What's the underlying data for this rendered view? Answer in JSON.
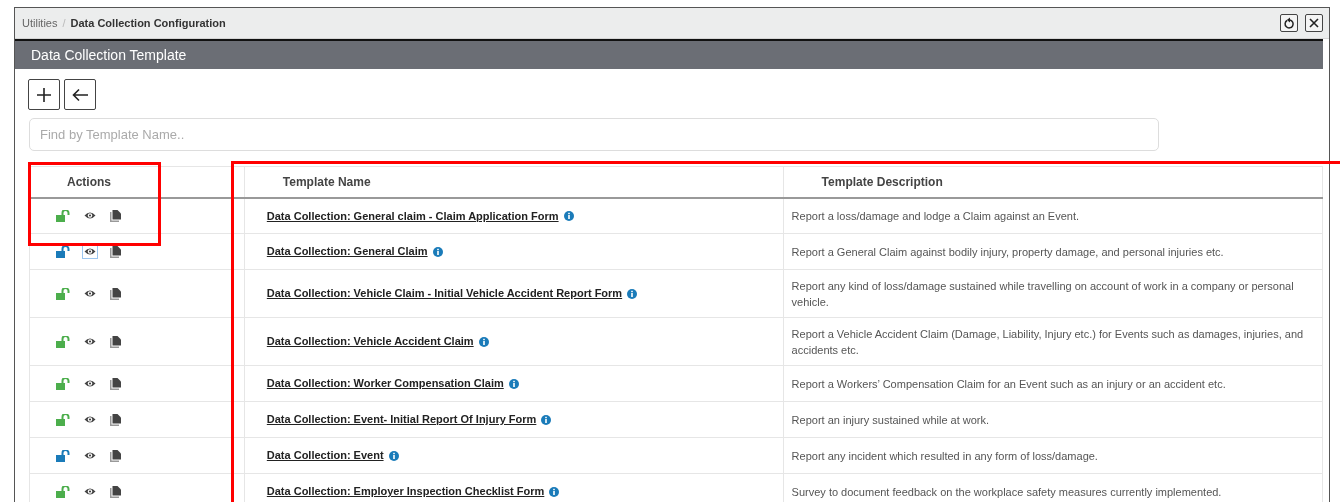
{
  "breadcrumb": {
    "separator": "/",
    "items": [
      {
        "label": "Utilities",
        "current": false
      },
      {
        "label": "Data Collection Configuration",
        "current": true
      }
    ]
  },
  "panel": {
    "title": "Data Collection Template"
  },
  "search": {
    "placeholder": "Find by Template Name.."
  },
  "table": {
    "columns": [
      "Actions",
      "Template Name",
      "Template Description"
    ],
    "rows": [
      {
        "color": "#4cae4c",
        "view_focused": false,
        "name": "Data Collection: General claim - Claim Application Form",
        "description": "Report a loss/damage and lodge a Claim against an Event."
      },
      {
        "color": "#1a7bb9",
        "view_focused": true,
        "name": "Data Collection: General Claim",
        "description": "Report a General Claim against bodily injury, property damage, and personal injuries etc."
      },
      {
        "color": "#4cae4c",
        "view_focused": false,
        "name": "Data Collection: Vehicle Claim - Initial Vehicle Accident Report Form",
        "description": "Report any kind of loss/damage sustained while travelling on account of work in a company or personal vehicle."
      },
      {
        "color": "#4cae4c",
        "view_focused": false,
        "name": "Data Collection: Vehicle Accident Claim",
        "description": "Report a Vehicle Accident Claim (Damage, Liability, Injury etc.) for Events such as damages, injuries, and accidents etc."
      },
      {
        "color": "#4cae4c",
        "view_focused": false,
        "name": "Data Collection: Worker Compensation Claim",
        "description": "Report a Workers’ Compensation Claim for an Event such as an injury or an accident etc."
      },
      {
        "color": "#4cae4c",
        "view_focused": false,
        "name": "Data Collection: Event- Initial Report Of Injury Form",
        "description": "Report an injury sustained while at work."
      },
      {
        "color": "#1a7bb9",
        "view_focused": false,
        "name": "Data Collection: Event",
        "description": "Report any incident which resulted in any form of loss/damage."
      },
      {
        "color": "#4cae4c",
        "view_focused": false,
        "name": "Data Collection: Employer Inspection Checklist Form",
        "description": "Survey to document feedback on the workplace safety measures currently implemented."
      }
    ]
  }
}
